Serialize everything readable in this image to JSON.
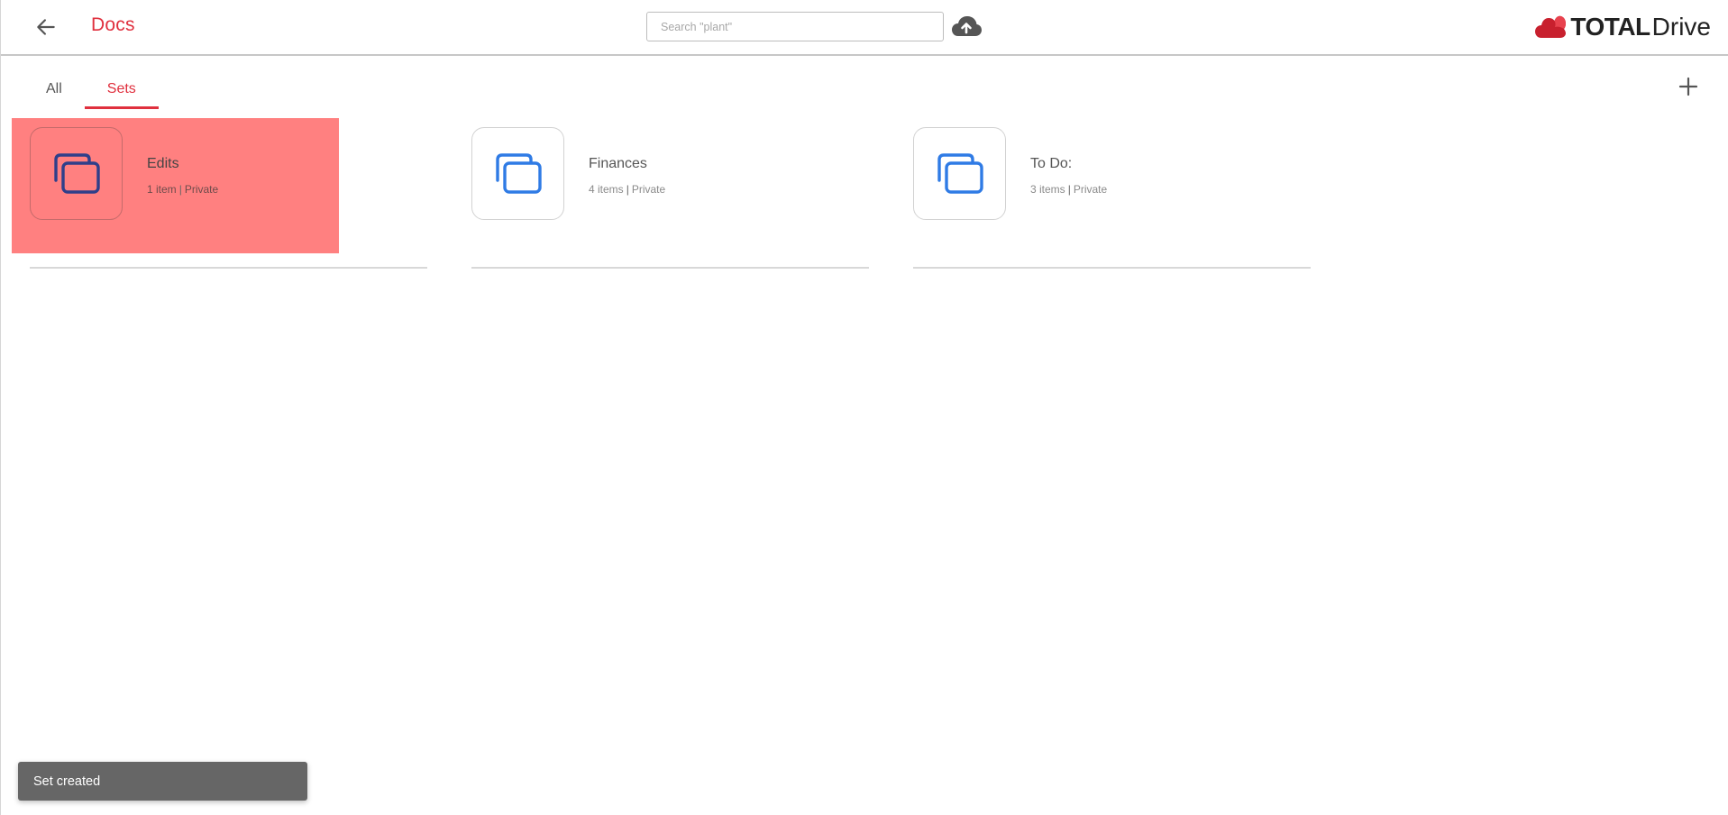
{
  "header": {
    "title": "Docs",
    "search_placeholder": "Search \"plant\"",
    "brand": {
      "bold": "TOTAL",
      "light": "Drive"
    }
  },
  "tabs": [
    {
      "label": "All",
      "active": false
    },
    {
      "label": "Sets",
      "active": true
    }
  ],
  "sets": [
    {
      "name": "Edits",
      "count": "1 item",
      "visibility": "Private",
      "selected": true
    },
    {
      "name": "Finances",
      "count": "4 items",
      "visibility": "Private",
      "selected": false
    },
    {
      "name": "To Do:",
      "count": "3 items",
      "visibility": "Private",
      "selected": false
    }
  ],
  "toast": {
    "message": "Set created"
  },
  "colors": {
    "accent": "#e0303e",
    "highlight": "#ff8080",
    "set_icon": "#2f7be5",
    "set_icon_selected": "#2f3f8a",
    "toast_bg": "#666666"
  },
  "icons": {
    "back": "arrow-left-icon",
    "upload": "cloud-upload-icon",
    "add": "plus-icon",
    "set": "stacked-cards-icon"
  }
}
